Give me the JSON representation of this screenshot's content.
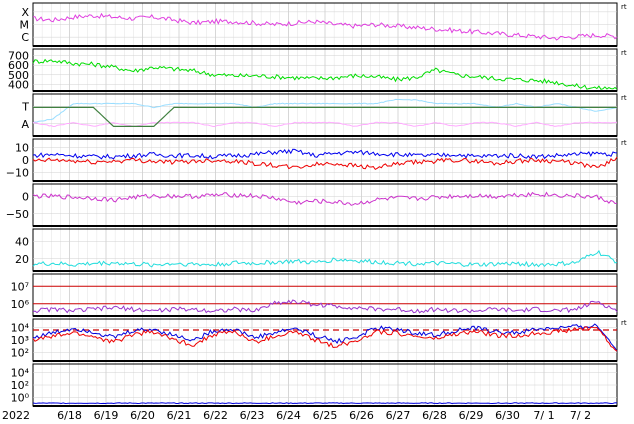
{
  "chart_data": {
    "type": "line",
    "year_label": "2022",
    "x_axis": {
      "start": "2022-06-17",
      "end": "2022-07-02",
      "tick_labels": [
        "6/18",
        "6/19",
        "6/20",
        "6/21",
        "6/22",
        "6/23",
        "6/24",
        "6/25",
        "6/26",
        "6/27",
        "6/28",
        "6/29",
        "6/30",
        "7/ 1",
        "7/ 2"
      ]
    },
    "panels": [
      {
        "id": "xray",
        "y_labels": [
          "X",
          "M",
          "C"
        ],
        "right_label": "rt",
        "series": [
          {
            "color": "#e040e0",
            "values": [
              2.3,
              2.2,
              2.4,
              2.5,
              2.4,
              2.3,
              2.4,
              2.2,
              2.0,
              2.1,
              2.1,
              2.0,
              1.9,
              2.0,
              2.1,
              1.9,
              1.8,
              1.9,
              1.8,
              1.7,
              1.6,
              1.5,
              1.4,
              1.3,
              1.2,
              1.1,
              1.0,
              1.1,
              1.2,
              1.1
            ]
          }
        ]
      },
      {
        "id": "solar-wind",
        "y_labels": [
          "700",
          "600",
          "500",
          "400"
        ],
        "right_label": "rt",
        "y_range": [
          330,
          730
        ],
        "series": [
          {
            "color": "#00dd00",
            "values": [
              620,
              630,
              600,
              590,
              560,
              520,
              560,
              540,
              520,
              480,
              470,
              470,
              460,
              450,
              440,
              450,
              470,
              460,
              430,
              450,
              530,
              480,
              460,
              440,
              430,
              420,
              400,
              360,
              340,
              340
            ]
          }
        ]
      },
      {
        "id": "imf-direction",
        "y_labels": [
          "T",
          "A"
        ],
        "right_label": "rt",
        "series": [
          {
            "color": "#99ddff",
            "values": [
              0.3,
              0.4,
              0.8,
              0.8,
              0.8,
              0.8,
              0.7,
              0.8,
              0.8,
              0.8,
              0.8,
              0.7,
              0.8,
              0.8,
              0.8,
              0.8,
              0.8,
              0.8,
              0.9,
              0.9,
              0.8,
              0.8,
              0.8,
              0.7,
              0.8,
              0.7,
              0.8,
              0.7,
              0.6,
              0.7
            ]
          },
          {
            "color": "#ffaaff",
            "values": [
              0.3,
              0.2,
              0.3,
              0.2,
              0.3,
              0.2,
              0.3,
              0.3,
              0.3,
              0.2,
              0.3,
              0.3,
              0.2,
              0.3,
              0.3,
              0.3,
              0.2,
              0.3,
              0.3,
              0.2,
              0.3,
              0.2,
              0.3,
              0.3,
              0.2,
              0.3,
              0.2,
              0.3,
              0.3,
              0.3
            ]
          },
          {
            "color": "#408040",
            "values": [
              0.7,
              0.7,
              0.7,
              0.7,
              0.2,
              0.2,
              0.2,
              0.7,
              0.7,
              0.7,
              0.7,
              0.7,
              0.7,
              0.7,
              0.7,
              0.7,
              0.7,
              0.7,
              0.7,
              0.7,
              0.7,
              0.7,
              0.7,
              0.7,
              0.7,
              0.7,
              0.7,
              0.7,
              0.7,
              0.7
            ]
          }
        ]
      },
      {
        "id": "imf-components",
        "y_labels": [
          "10",
          "0",
          "−10"
        ],
        "right_label": "rt",
        "y_range": [
          -16,
          18
        ],
        "series": [
          {
            "color": "#0000ee",
            "values": [
              5,
              6,
              5,
              4,
              4,
              5,
              6,
              5,
              5,
              4,
              5,
              6,
              8,
              9,
              5,
              7,
              8,
              7,
              6,
              5,
              5,
              6,
              4,
              5,
              5,
              4,
              5,
              6,
              7,
              6
            ]
          },
          {
            "color": "#ee0000",
            "values": [
              0,
              1,
              0,
              -1,
              0,
              1,
              0,
              -1,
              0,
              1,
              0,
              -2,
              -4,
              -6,
              -3,
              -2,
              -4,
              -6,
              -3,
              -1,
              0,
              1,
              0,
              -2,
              0,
              1,
              0,
              -2,
              -6,
              3
            ]
          }
        ]
      },
      {
        "id": "dst",
        "y_labels": [
          "0",
          "−50"
        ],
        "y_range": [
          -75,
          20
        ],
        "series": [
          {
            "color": "#cc33cc",
            "values": [
              -5,
              -6,
              -8,
              -10,
              -15,
              -8,
              -5,
              -5,
              -6,
              -3,
              -2,
              -5,
              -10,
              -22,
              -18,
              -20,
              -25,
              -15,
              -10,
              -12,
              -8,
              -5,
              -4,
              -6,
              -2,
              0,
              -3,
              -5,
              -8,
              -25
            ]
          }
        ]
      },
      {
        "id": "ap",
        "y_labels": [
          "40",
          "20"
        ],
        "y_range": [
          0,
          55
        ],
        "series": [
          {
            "color": "#22dddd",
            "values": [
              7,
              8,
              6,
              8,
              9,
              7,
              6,
              8,
              7,
              6,
              9,
              8,
              10,
              11,
              9,
              14,
              12,
              10,
              9,
              8,
              8,
              7,
              6,
              7,
              8,
              6,
              7,
              9,
              25,
              10
            ]
          }
        ]
      },
      {
        "id": "electron-flux",
        "y_labels": [
          "10⁷",
          "10⁶"
        ],
        "thresholds": [
          7,
          6
        ],
        "series": [
          {
            "color": "#9933cc",
            "values": [
              5.2,
              5.3,
              5.2,
              5.3,
              5.4,
              5.3,
              5.2,
              5.3,
              5.3,
              5.2,
              5.3,
              5.2,
              5.7,
              5.8,
              5.6,
              5.5,
              5.4,
              5.3,
              5.3,
              5.2,
              5.3,
              5.2,
              5.2,
              5.3,
              5.2,
              5.3,
              5.2,
              5.3,
              5.8,
              5.2
            ]
          }
        ]
      },
      {
        "id": "proton-flux",
        "y_labels": [
          "10⁴",
          "10³",
          "10²"
        ],
        "right_label": "rt",
        "threshold": 3.7,
        "series": [
          {
            "color": "#0000dd",
            "values": [
              2.8,
              3.2,
              3.6,
              3.3,
              2.8,
              3.4,
              3.5,
              3.0,
              2.6,
              3.4,
              3.5,
              2.8,
              3.2,
              3.6,
              3.0,
              2.5,
              2.8,
              3.6,
              3.5,
              3.2,
              3.0,
              3.4,
              3.6,
              3.3,
              3.2,
              3.5,
              3.6,
              3.7,
              3.8,
              1.8
            ]
          },
          {
            "color": "#ee0000",
            "values": [
              2.6,
              2.9,
              3.2,
              2.9,
              2.4,
              3.1,
              3.3,
              2.6,
              2.2,
              3.1,
              3.3,
              2.4,
              2.9,
              3.3,
              2.6,
              2.1,
              2.5,
              3.3,
              3.2,
              2.9,
              2.7,
              3.1,
              3.3,
              3.0,
              2.9,
              3.2,
              3.3,
              3.5,
              3.7,
              1.5
            ]
          }
        ]
      },
      {
        "id": "proton-high",
        "y_labels": [
          "10⁴",
          "10²",
          "10⁰"
        ],
        "series": [
          {
            "color": "#0000dd",
            "values": [
              0.1,
              0.1,
              0.1,
              0.1,
              0.1,
              0.1,
              0.1,
              0.1,
              0.1,
              0.1,
              0.1,
              0.1,
              0.1,
              0.1,
              0.1,
              0.1,
              0.1,
              0.1,
              0.1,
              0.1,
              0.1,
              0.1,
              0.1,
              0.1,
              0.1,
              0.1,
              0.1,
              0.1,
              0.1,
              0.1
            ]
          }
        ]
      }
    ]
  }
}
